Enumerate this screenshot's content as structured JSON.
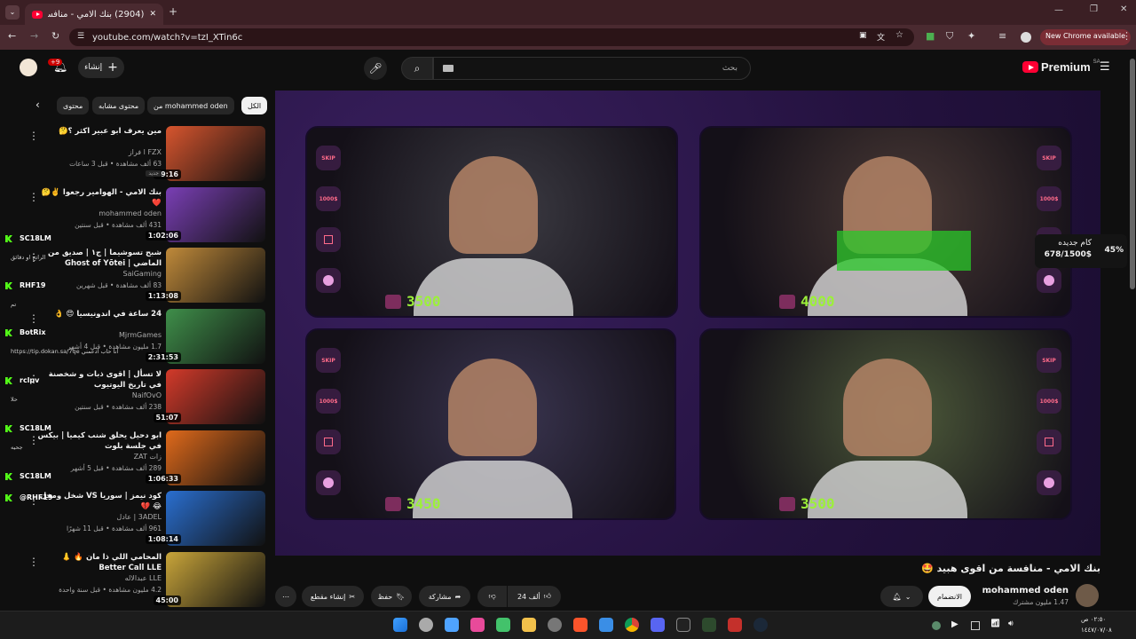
{
  "browser": {
    "tab_title": "(2904) بنك الامي - منافسة من اقوى هبيد",
    "url": "youtube.com/watch?v=tzI_XTin6c",
    "new_chrome": "New Chrome available"
  },
  "header": {
    "create_label": "إنشاء",
    "notif_badge": "+9",
    "search_placeholder": "بحث",
    "logo_text": "Premium",
    "country": "SA"
  },
  "chips": [
    "الكل",
    "من mohammed oden",
    "محتوى مشابه",
    "محتوى"
  ],
  "recommendations": [
    {
      "title": "مين يعرف ابو عبير اكثر ؟🤔",
      "channel": "FZX ا فراز",
      "meta": "63 ألف مشاهدة • قبل 3 ساعات",
      "badge": "جديد",
      "duration": "49:16",
      "thumb_color": "#d7552e"
    },
    {
      "title": "بنك الامي - الهوامير رجعوا ✌️🤔 ❤️",
      "channel": "mohammed oden",
      "meta": "431 ألف مشاهدة • قبل سنتين",
      "badge": "",
      "duration": "1:02:06",
      "thumb_color": "#7a3fb5"
    },
    {
      "title": "شبح تسوشيما | ج١ | صديق من الماضي | Ghost of Yōtei",
      "channel": "SaiGaming",
      "meta": "83 ألف مشاهدة • قبل شهرين",
      "badge": "",
      "duration": "1:13:08",
      "thumb_color": "#c08a3a"
    },
    {
      "title": "24 ساعة في اندونيسيا 😍 👌",
      "channel": "MjrmGames",
      "meta": "1.7 مليون مشاهدة • قبل 4 أشهر",
      "badge": "",
      "duration": "2:31:53",
      "thumb_color": "#3f8f4a"
    },
    {
      "title": "لا تسأل | اقوى ذبات و شخصنة في تاريخ اليوتيوب",
      "channel": "NaifOvO",
      "meta": "238 ألف مشاهدة • قبل سنتين",
      "badge": "",
      "duration": "51:07",
      "thumb_color": "#d33a2a"
    },
    {
      "title": "ابو دحيل يحلق شنب كيميا | بيكس في جلسة بلوت",
      "channel": "زات ZAT",
      "meta": "289 ألف مشاهدة • قبل 5 أشهر",
      "badge": "",
      "duration": "1:06:33",
      "thumb_color": "#e06a1b"
    },
    {
      "title": "كود نيمز | سوريا VS شخل ومخل 😂 💔",
      "channel": "3ADEL | عادل",
      "meta": "961 ألف مشاهدة • قبل 11 شهرًا",
      "badge": "",
      "duration": "1:08:14",
      "thumb_color": "#2a6fd0"
    },
    {
      "title": "المحامي اللي ذا مان 🔥 👃 Better Call LLE",
      "channel": "LLE عبدالاله",
      "meta": "4.2 مليون مشاهدة • قبل سنة واحدة",
      "badge": "",
      "duration": "45:00",
      "thumb_color": "#c9a53a"
    }
  ],
  "chat": [
    {
      "name": "SC18LM",
      "msg": "الراتج او دقائق"
    },
    {
      "name": "RHF19",
      "msg": "تم"
    },
    {
      "name": "BotRix",
      "msg": "https://tip.dokan.sa/7qe  انا حاب ادعمني"
    },
    {
      "name": "rclpv",
      "msg": "حلا"
    },
    {
      "name": "SC18LM",
      "msg": "جحيه"
    },
    {
      "name": "SC18LM",
      "msg": ""
    },
    {
      "name": "@RHF19",
      "msg": ""
    }
  ],
  "video": {
    "scores": [
      "3500",
      "4000",
      "3450",
      "3500"
    ],
    "skip_label": "SKIP",
    "price_label": "1000$",
    "overlay_title": "كام جديده",
    "overlay_progress": "678/1500$",
    "overlay_percent": "45%",
    "cam_colors": [
      "#3b3a42",
      "#4a3a36",
      "#3a3550",
      "#4d5a3a"
    ]
  },
  "below": {
    "title": "بنك الامي - منافسة من اقوى هبيد 🤩",
    "channel": "mohammed oden",
    "subs": "1.47 مليون مشترك",
    "join": "الانضمام",
    "likes": "24 ألف",
    "share": "مشاركة",
    "save": "حفظ",
    "clip": "إنشاء مقطع"
  },
  "taskbar": {
    "time": "٠٢:٥٠ ص",
    "date": "١٤٤٧/٠٧/٠٨"
  }
}
